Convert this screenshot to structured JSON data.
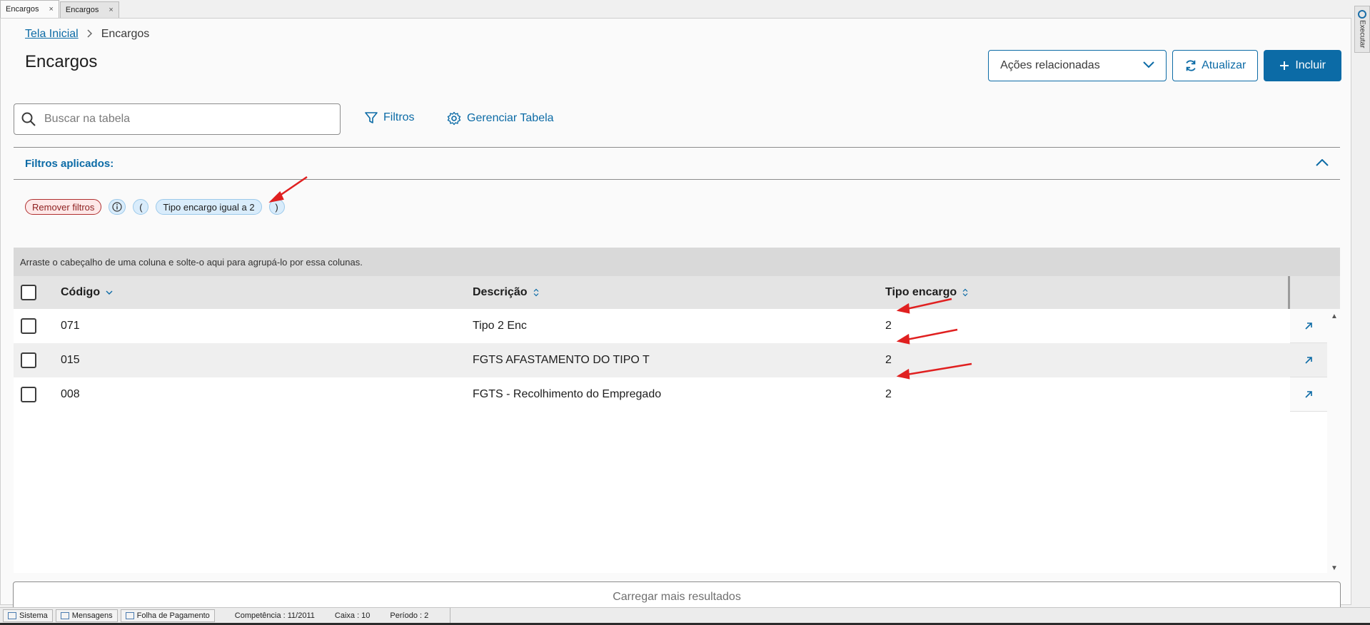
{
  "window_tabs": [
    {
      "label": "Encargos",
      "close": "×"
    },
    {
      "label": "Encargos",
      "close": "×"
    }
  ],
  "side_tab": {
    "label": "Executar"
  },
  "breadcrumb": {
    "home": "Tela Inicial",
    "current": "Encargos"
  },
  "page_title": "Encargos",
  "actions": {
    "related": "Ações relacionadas",
    "refresh": "Atualizar",
    "include": "Incluir"
  },
  "search": {
    "placeholder": "Buscar na tabela"
  },
  "toolbar": {
    "filters": "Filtros",
    "manage_table": "Gerenciar Tabela"
  },
  "applied_filters": {
    "title": "Filtros aplicados:",
    "remove": "Remover filtros",
    "open_paren": "(",
    "filter": "Tipo encargo igual a 2",
    "close_paren": ")"
  },
  "group_hint": "Arraste o cabeçalho de uma coluna e solte-o aqui para agrupá-lo por essa colunas.",
  "table": {
    "columns": [
      "Código",
      "Descrição",
      "Tipo encargo"
    ],
    "rows": [
      {
        "code": "071",
        "desc": "Tipo 2 Enc",
        "tipo": "2"
      },
      {
        "code": "015",
        "desc": "FGTS AFASTAMENTO DO TIPO T",
        "tipo": "2"
      },
      {
        "code": "008",
        "desc": "FGTS - Recolhimento do Empregado",
        "tipo": "2"
      }
    ]
  },
  "load_more": "Carregar mais resultados",
  "statusbar": {
    "sistema": "Sistema",
    "mensagens": "Mensagens",
    "folha": "Folha de Pagamento",
    "competencia": "Competência : 11/2011",
    "caixa": "Caixa : 10",
    "periodo": "Período : 2"
  },
  "colors": {
    "accent": "#0c6ba6",
    "annotation": "#e02020"
  }
}
